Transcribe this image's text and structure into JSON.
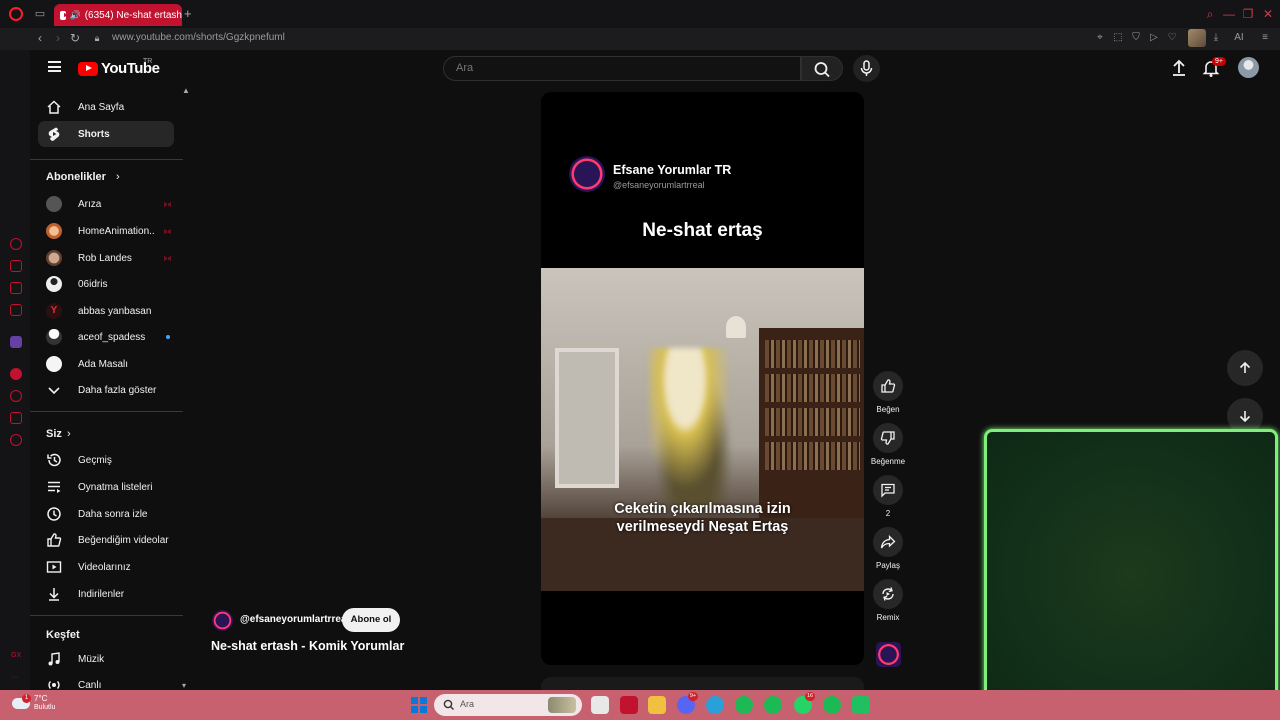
{
  "browser": {
    "tab_title": "(6354) Ne-shat ertash",
    "url": "www.youtube.com/shorts/Ggzkpnefuml",
    "ext_ai_label": "AI"
  },
  "header": {
    "logo_text": "YouTube",
    "country": "TR",
    "search_placeholder": "Ara",
    "notif_count": "9+"
  },
  "sidebar": {
    "main": [
      {
        "label": "Ana Sayfa",
        "icon": "home-icon"
      },
      {
        "label": "Shorts",
        "icon": "shorts-icon"
      }
    ],
    "subs_title": "Abonelikler",
    "subscriptions": [
      {
        "label": "Arıza",
        "status": "live"
      },
      {
        "label": "HomeAnimation...",
        "status": "live"
      },
      {
        "label": "Rob Landes",
        "status": "live"
      },
      {
        "label": "06idris",
        "status": ""
      },
      {
        "label": "abbas yanbasan",
        "status": ""
      },
      {
        "label": "aceof_spadess",
        "status": "new"
      },
      {
        "label": "Ada Masalı",
        "status": ""
      }
    ],
    "show_more": "Daha fazla göster",
    "you_title": "Siz",
    "you_items": [
      {
        "label": "Geçmiş",
        "icon": "history-icon"
      },
      {
        "label": "Oynatma listeleri",
        "icon": "playlist-icon"
      },
      {
        "label": "Daha sonra izle",
        "icon": "clock-icon"
      },
      {
        "label": "Beğendiğim videolar",
        "icon": "like-icon"
      },
      {
        "label": "Videolarınız",
        "icon": "video-icon"
      },
      {
        "label": "İndirilenler",
        "icon": "download-icon"
      }
    ],
    "explore_title": "Keşfet",
    "explore_items": [
      {
        "label": "Müzik",
        "icon": "music-icon"
      },
      {
        "label": "Canlı",
        "icon": "live-icon"
      }
    ]
  },
  "short": {
    "overlay_channel": "Efsane Yorumlar TR",
    "overlay_handle": "@efsaneyorumlartrreal",
    "overlay_title": "Ne-shat ertaş",
    "caption_line1": "Ceketin çıkarılmasına izin",
    "caption_line2": "verilmeseydi Neşat Ertaş",
    "channel_handle": "@efsaneyorumlartrreal",
    "subscribe_label": "Abone ol",
    "title": "Ne-shat ertash - Komik Yorumlar"
  },
  "actions": {
    "like": "Beğen",
    "dislike": "Beğenme",
    "comments": "2",
    "share": "Paylaş",
    "remix": "Remix"
  },
  "taskbar": {
    "temp": "7°C",
    "condition": "Bulutlu",
    "weather_badge": "1",
    "search_text": "Ara",
    "discord_badge": "9+",
    "whatsapp_badge": "16"
  },
  "colors": {
    "accent_red": "#ff0000",
    "opera_red": "#c1122f",
    "taskbar": "#c8616f",
    "float_border": "#7ef07a"
  }
}
